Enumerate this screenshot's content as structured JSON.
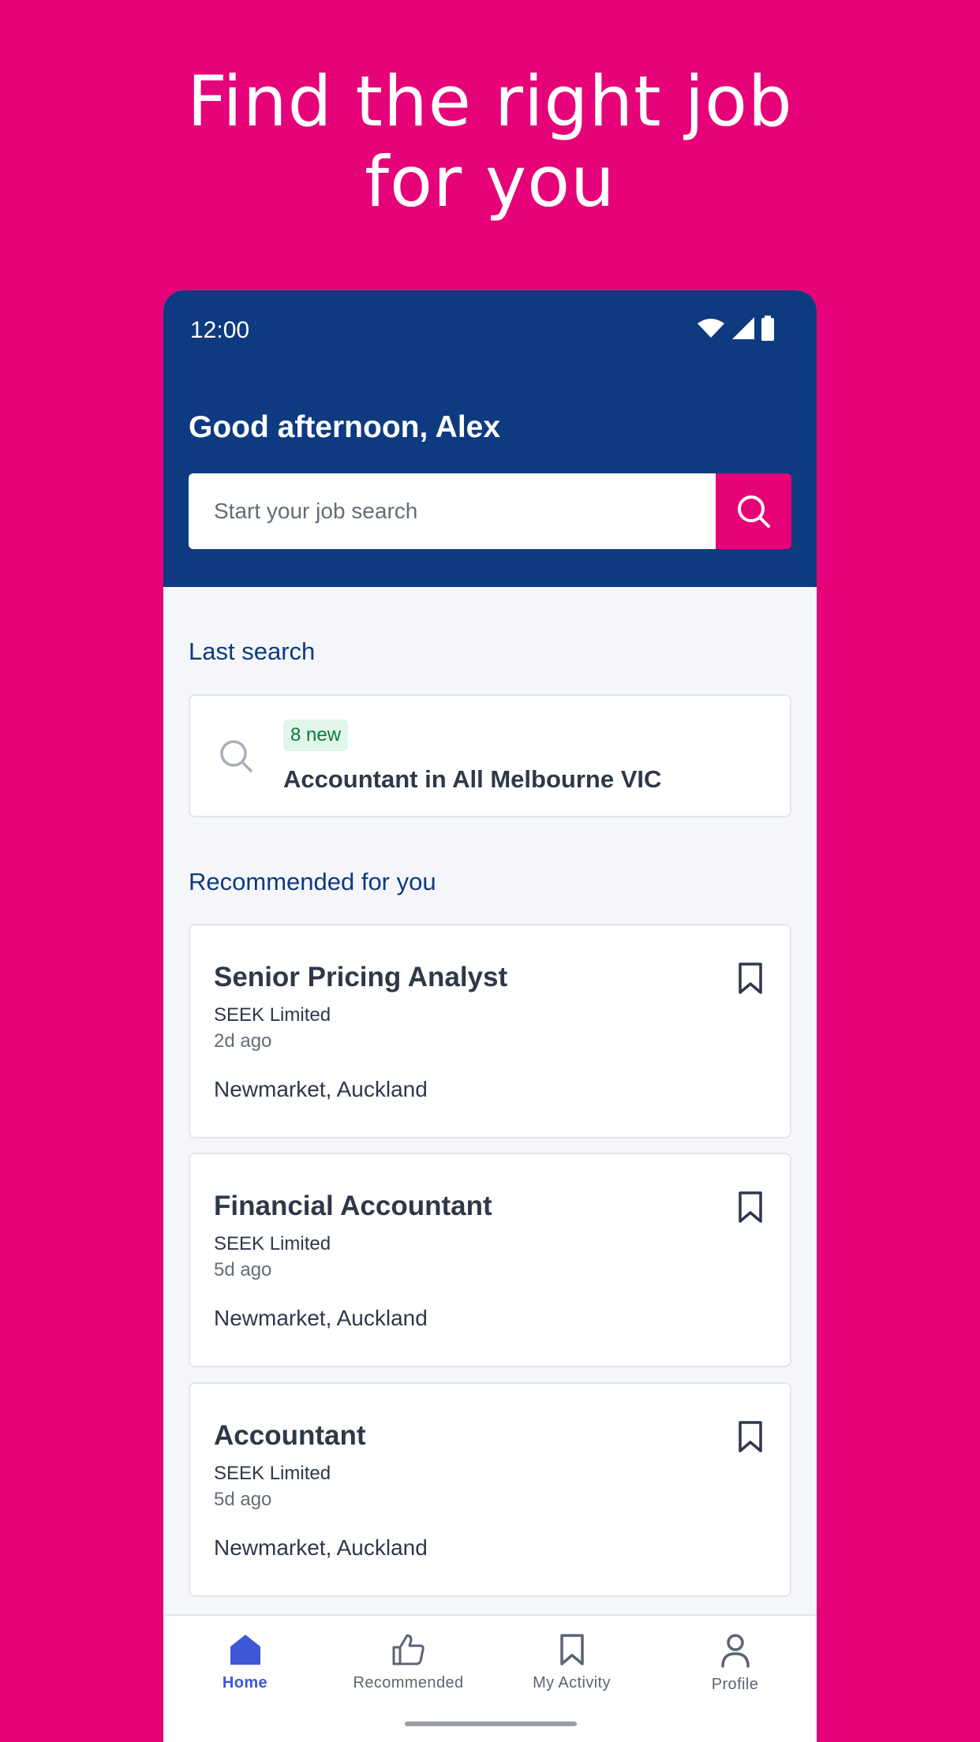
{
  "hero": {
    "line1": "Find the right job",
    "line2": "for you"
  },
  "status_bar": {
    "time": "12:00",
    "icons": [
      "wifi-icon",
      "cell-signal-icon",
      "battery-icon"
    ]
  },
  "header": {
    "greeting": "Good afternoon, Alex",
    "search_placeholder": "Start your job search"
  },
  "last_search": {
    "section_title": "Last search",
    "badge": "8 new",
    "query": "Accountant in All Melbourne VIC"
  },
  "recommended": {
    "section_title": "Recommended for you",
    "jobs": [
      {
        "title": "Senior Pricing Analyst",
        "company": "SEEK Limited",
        "age": "2d ago",
        "location": "Newmarket, Auckland"
      },
      {
        "title": "Financial Accountant",
        "company": "SEEK Limited",
        "age": "5d ago",
        "location": "Newmarket, Auckland"
      },
      {
        "title": "Accountant",
        "company": "SEEK Limited",
        "age": "5d ago",
        "location": "Newmarket, Auckland"
      }
    ]
  },
  "bottom_nav": {
    "items": [
      {
        "label": "Home",
        "icon": "home-icon",
        "active": true
      },
      {
        "label": "Recommended",
        "icon": "thumbs-up-icon",
        "active": false
      },
      {
        "label": "My Activity",
        "icon": "bookmark-icon",
        "active": false
      },
      {
        "label": "Profile",
        "icon": "person-icon",
        "active": false
      }
    ]
  },
  "colors": {
    "brand_pink": "#e60278",
    "header_navy": "#0e3a80",
    "active_nav": "#3d57d6",
    "badge_green": "#0c7a3c"
  }
}
